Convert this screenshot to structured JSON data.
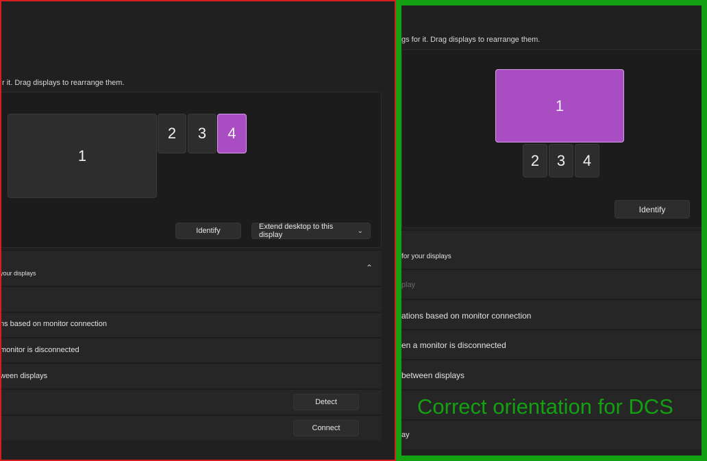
{
  "left": {
    "arrange_text": "r it. Drag displays to rearrange them.",
    "monitors": [
      {
        "label": "1",
        "active": false
      },
      {
        "label": "2",
        "active": false
      },
      {
        "label": "3",
        "active": false
      },
      {
        "label": "4",
        "active": true
      }
    ],
    "identify_label": "Identify",
    "dropdown_label": "Extend desktop to this display",
    "section_header": "your displays",
    "rows": [
      "",
      "ns based on monitor connection",
      "monitor is disconnected",
      "ween displays"
    ],
    "detect_label": "Detect",
    "connect_label": "Connect"
  },
  "right": {
    "arrange_text": "gs for it. Drag displays to rearrange them.",
    "monitors": [
      {
        "label": "1",
        "active": true
      },
      {
        "label": "2",
        "active": false
      },
      {
        "label": "3",
        "active": false
      },
      {
        "label": "4",
        "active": false
      }
    ],
    "identify_label": "Identify",
    "section_header": "for your displays",
    "rows": [
      "play",
      "ations based on monitor connection",
      "en a monitor is disconnected",
      "between displays",
      "",
      "ay"
    ],
    "overlay_text": "Correct orientation for DCS"
  },
  "colors": {
    "left_frame": "#d81e1e",
    "right_frame": "#13a112",
    "active_monitor": "#a84ec2",
    "overlay_text": "#13a112"
  }
}
